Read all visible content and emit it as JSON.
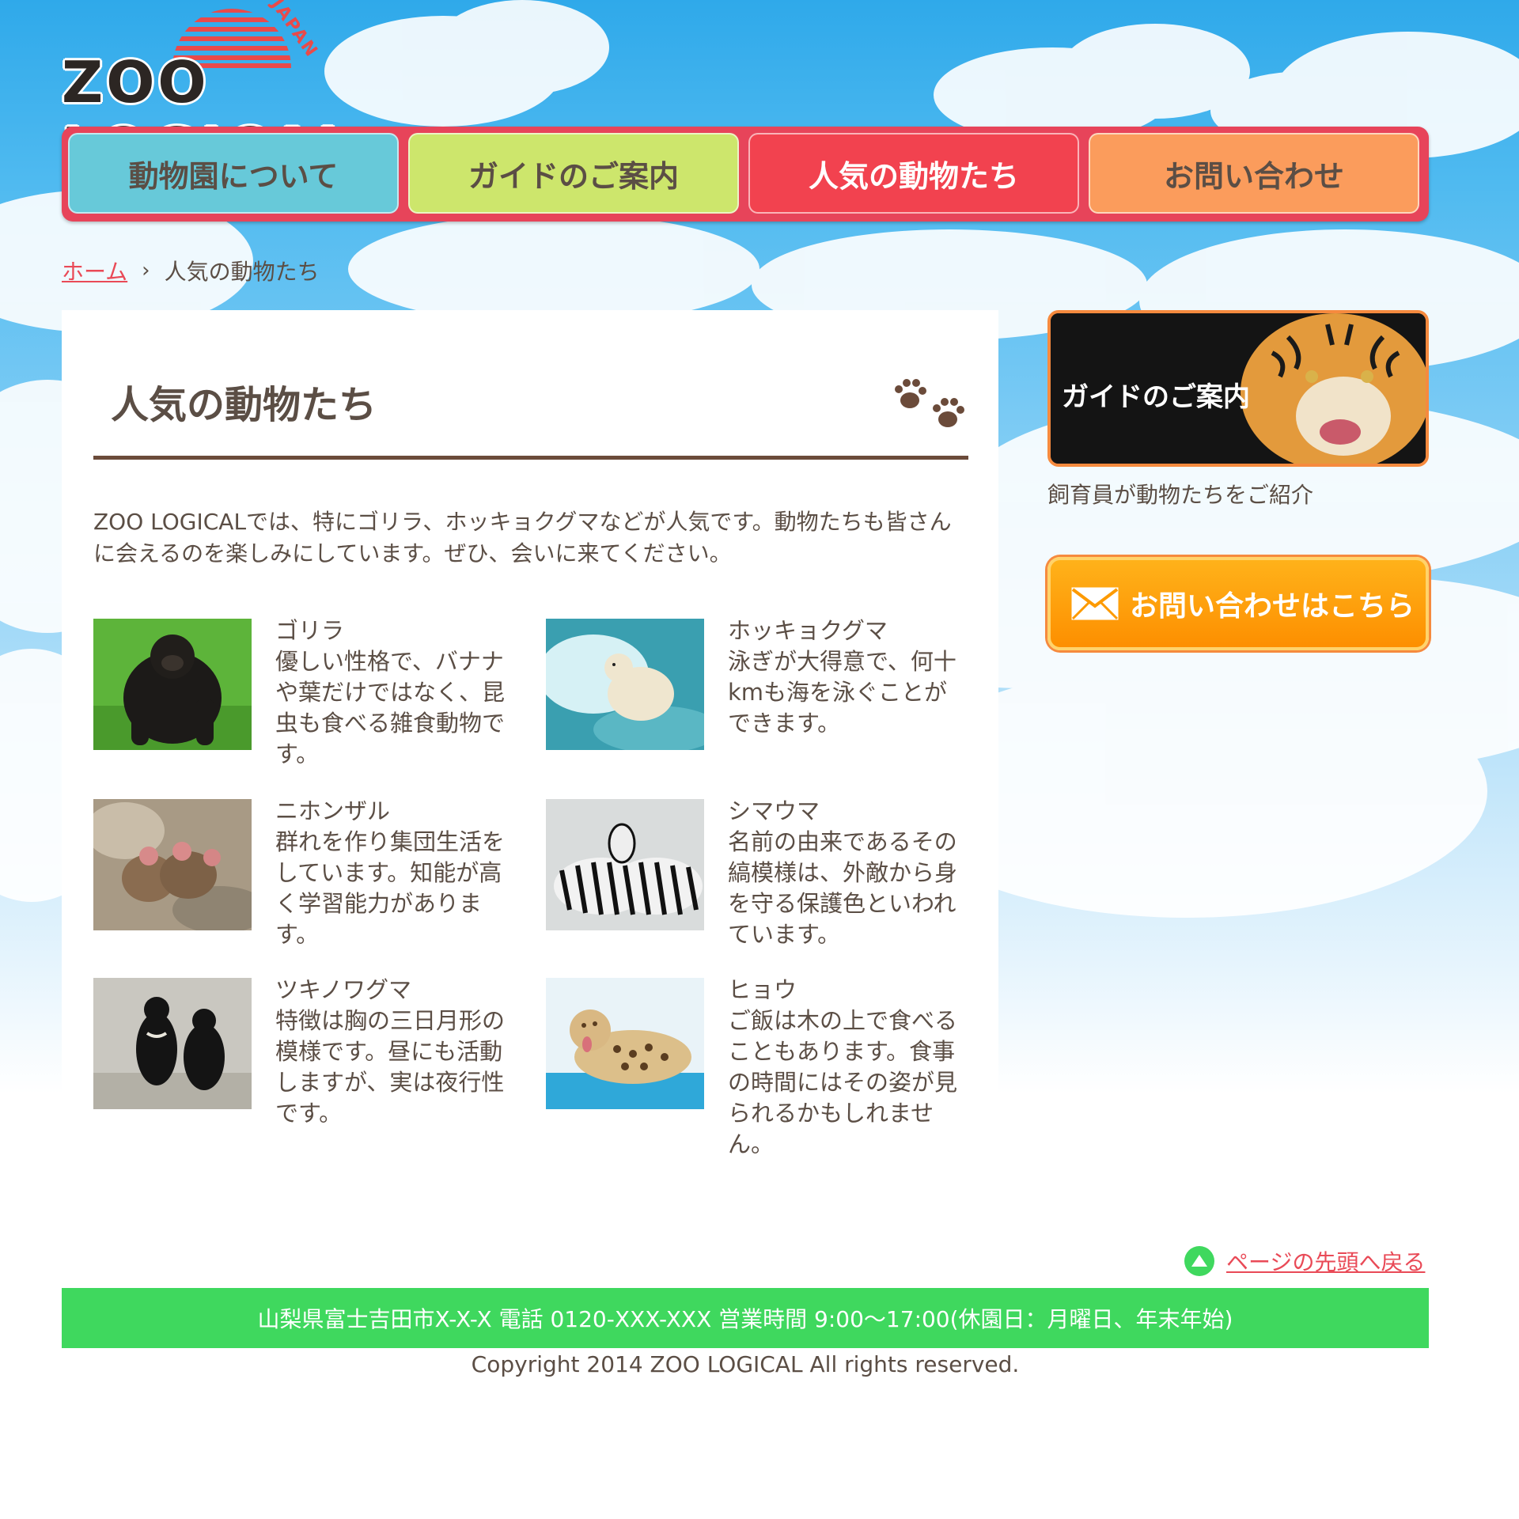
{
  "logo": {
    "name": "ZOO LOGICAL",
    "sub": "JAPAN"
  },
  "nav": {
    "items": [
      {
        "label": "動物園について"
      },
      {
        "label": "ガイドのご案内"
      },
      {
        "label": "人気の動物たち"
      },
      {
        "label": "お問い合わせ"
      }
    ]
  },
  "breadcrumb": {
    "home": "ホーム",
    "current": "人気の動物たち"
  },
  "main": {
    "title": "人気の動物たち",
    "intro": "ZOO LOGICALでは、特にゴリラ、ホッキョクグマなどが人気です。動物たちも皆さんに会えるのを楽しみにしています。ぜひ、会いに来てください。",
    "animals": [
      {
        "name": "ゴリラ",
        "desc": "優しい性格で、バナナや葉だけではなく、昆虫も食べる雑食動物です。"
      },
      {
        "name": "ホッキョクグマ",
        "desc": "泳ぎが大得意で、何十kmも海を泳ぐことができます。"
      },
      {
        "name": "ニホンザル",
        "desc": "群れを作り集団生活をしています。知能が高く学習能力があります。"
      },
      {
        "name": "シマウマ",
        "desc": "名前の由来であるその縞模様は、外敵から身を守る保護色といわれています。"
      },
      {
        "name": "ツキノワグマ",
        "desc": "特徴は胸の三日月形の模様です。昼にも活動しますが、実は夜行性です。"
      },
      {
        "name": "ヒョウ",
        "desc": "ご飯は木の上で食べることもあります。食事の時間にはその姿が見られるかもしれません。"
      }
    ]
  },
  "sidebar": {
    "guide_label": "ガイドのご案内",
    "guide_caption": "飼育員が動物たちをご紹介",
    "contact_label": "お問い合わせはこちら"
  },
  "footer": {
    "pagetop": "ページの先頭へ戻る",
    "address": "山梨県富士吉田市X-X-X 電話 0120-XXX-XXX 営業時間 9:00～17:00(休園日：月曜日、年末年始)",
    "copyright": "Copyright 2014 ZOO LOGICAL All rights reserved."
  },
  "colors": {
    "nav_frame": "#e7445a",
    "nav_1": "#67c9d9",
    "nav_2": "#cde66c",
    "nav_3": "#f2424f",
    "nav_4": "#fb9c5c",
    "text": "#5b4e45",
    "link": "#e94a57",
    "footer": "#3fd85e",
    "contact": "#fd9a00"
  }
}
